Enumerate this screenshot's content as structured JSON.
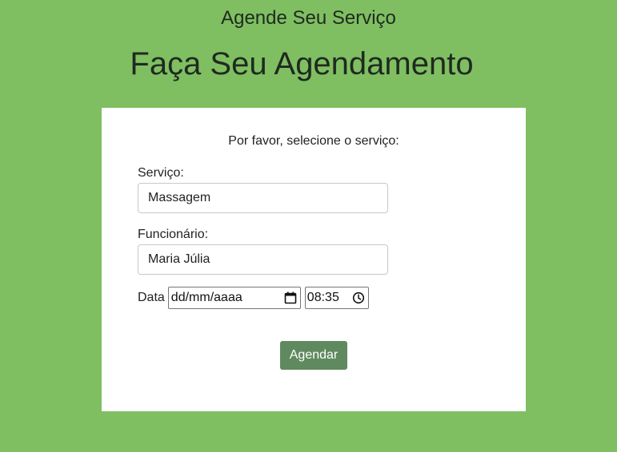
{
  "header": {
    "site_title": "Agende Seu Serviço",
    "page_heading": "Faça Seu Agendamento"
  },
  "form": {
    "instruction": "Por favor, selecione o serviço:",
    "service": {
      "label": "Serviço:",
      "value": "Massagem"
    },
    "employee": {
      "label": "Funcionário:",
      "value": "Maria Júlia"
    },
    "date": {
      "label": "Data",
      "placeholder": "dd/mm/aaaa",
      "time_value": "08:35"
    },
    "submit_label": "Agendar"
  },
  "icons": {
    "date_picker": "calendar-icon",
    "time_picker": "clock-icon"
  },
  "colors": {
    "page_background": "#7fbf62",
    "card_background": "#ffffff",
    "button_background": "#5f8a5f",
    "button_text": "#ffffff"
  }
}
